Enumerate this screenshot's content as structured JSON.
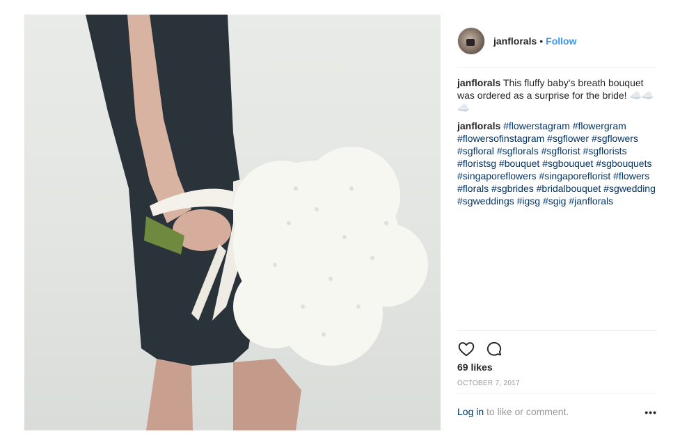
{
  "post": {
    "username": "janflorals",
    "separator": "•",
    "follow_label": "Follow",
    "caption": {
      "username": "janflorals",
      "text": "This fluffy baby's breath bouquet was ordered as a surprise for the bride! ☁️☁️☁️"
    },
    "comment": {
      "username": "janflorals",
      "hashtags": [
        "#flowerstagram",
        "#flowergram",
        "#flowersofinstagram",
        "#sgflower",
        "#sgflowers",
        "#sgfloral",
        "#sgflorals",
        "#sgflorist",
        "#sgflorists",
        "#floristsg",
        "#bouquet",
        "#sgbouquet",
        "#sgbouquets",
        "#singaporeflowers",
        "#singaporeflorist",
        "#flowers",
        "#florals",
        "#sgbrides",
        "#bridalbouquet",
        "#sgwedding",
        "#sgweddings",
        "#igsg",
        "#sgig",
        "#janflorals"
      ]
    },
    "actions": {
      "like_icon": "heart-icon",
      "comment_icon": "comment-icon"
    },
    "likes": "69 likes",
    "date": "OCTOBER 7, 2017",
    "login_link": "Log in",
    "login_text": " to like or comment.",
    "more_label": "•••"
  }
}
